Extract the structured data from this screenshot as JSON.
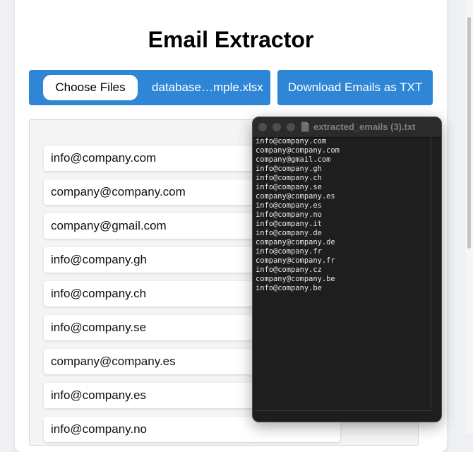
{
  "app": {
    "title": "Email Extractor"
  },
  "upload": {
    "choose_label": "Choose Files",
    "file_name": "database…mple.xlsx"
  },
  "download": {
    "label": "Download Emails as TXT"
  },
  "emails": [
    "info@company.com",
    "company@company.com",
    "company@gmail.com",
    "info@company.gh",
    "info@company.ch",
    "info@company.se",
    "company@company.es",
    "info@company.es",
    "info@company.no"
  ],
  "txt_window": {
    "title": "extracted_emails (3).txt",
    "lines": [
      "info@company.com",
      "company@company.com",
      "company@gmail.com",
      "info@company.gh",
      "info@company.ch",
      "info@company.se",
      "company@company.es",
      "info@company.es",
      "info@company.no",
      "info@company.it",
      "info@company.de",
      "company@company.de",
      "info@company.fr",
      "company@company.fr",
      "info@company.cz",
      "company@company.be",
      "info@company.be"
    ]
  },
  "colors": {
    "primary": "#2f86d6",
    "page_background": "#eef0f3",
    "terminal_background": "#1e1e1e"
  }
}
